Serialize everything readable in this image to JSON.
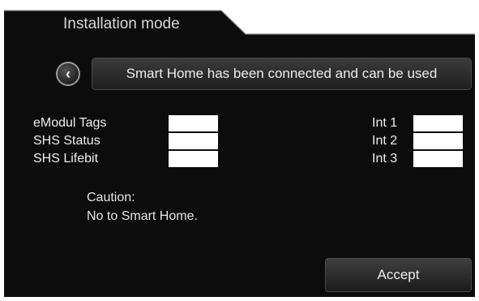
{
  "header": {
    "title": "Installation mode"
  },
  "toolbar": {
    "back_glyph": "‹",
    "message": "Smart Home has been connected and can be used"
  },
  "fields_left": [
    {
      "label": "eModul Tags",
      "value": ""
    },
    {
      "label": "SHS Status",
      "value": ""
    },
    {
      "label": "SHS Lifebit",
      "value": ""
    }
  ],
  "fields_right": [
    {
      "label": "Int 1",
      "value": ""
    },
    {
      "label": "Int 2",
      "value": ""
    },
    {
      "label": "Int 3",
      "value": ""
    }
  ],
  "caution": {
    "line1": "Caution:",
    "line2": "No to Smart Home."
  },
  "footer": {
    "accept_label": "Accept"
  },
  "colors": {
    "background": "#0c0c0c",
    "text": "#eeeeee",
    "field": "#ffffff"
  }
}
